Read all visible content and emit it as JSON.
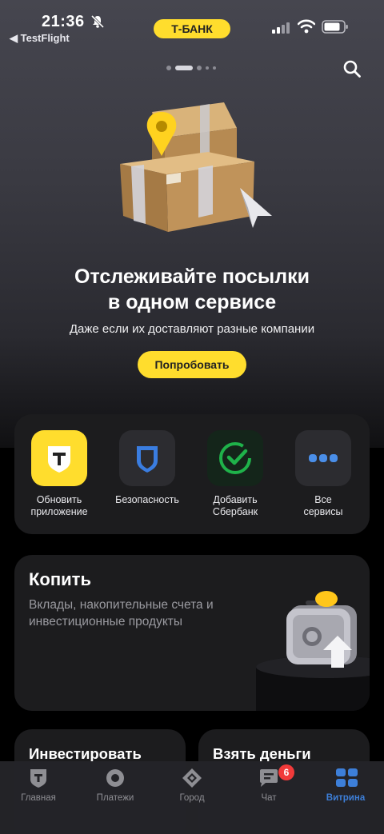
{
  "status_bar": {
    "time": "21:36",
    "back_app": "◀ TestFlight",
    "brand": "Т-БАНК"
  },
  "hero": {
    "title_line1": "Отслеживайте посылки",
    "title_line2": "в одном сервисе",
    "subtitle": "Даже если их доставляют разные компании",
    "button": "Попробовать"
  },
  "services": [
    {
      "label_line1": "Обновить",
      "label_line2": "приложение",
      "icon": "tbank-shield-icon"
    },
    {
      "label_line1": "Безопасность",
      "label_line2": "",
      "icon": "shield-icon"
    },
    {
      "label_line1": "Добавить",
      "label_line2": "Сбербанк",
      "icon": "sber-icon"
    },
    {
      "label_line1": "Все",
      "label_line2": "сервисы",
      "icon": "dots-icon"
    }
  ],
  "save_card": {
    "title": "Копить",
    "description": "Вклады, накопительные счета и инвестиционные продукты"
  },
  "mini_cards": [
    {
      "title": "Инвестировать"
    },
    {
      "title": "Взять деньги"
    }
  ],
  "tabs": [
    {
      "label": "Главная",
      "icon": "home-icon"
    },
    {
      "label": "Платежи",
      "icon": "payments-icon"
    },
    {
      "label": "Город",
      "icon": "city-icon"
    },
    {
      "label": "Чат",
      "icon": "chat-icon",
      "badge": "6"
    },
    {
      "label": "Витрина",
      "icon": "showcase-icon",
      "active": true
    }
  ],
  "colors": {
    "accent_yellow": "#ffdd2d",
    "active_tab": "#3d7fd9",
    "badge_red": "#f13a3a",
    "card_bg": "#1c1c1e"
  }
}
